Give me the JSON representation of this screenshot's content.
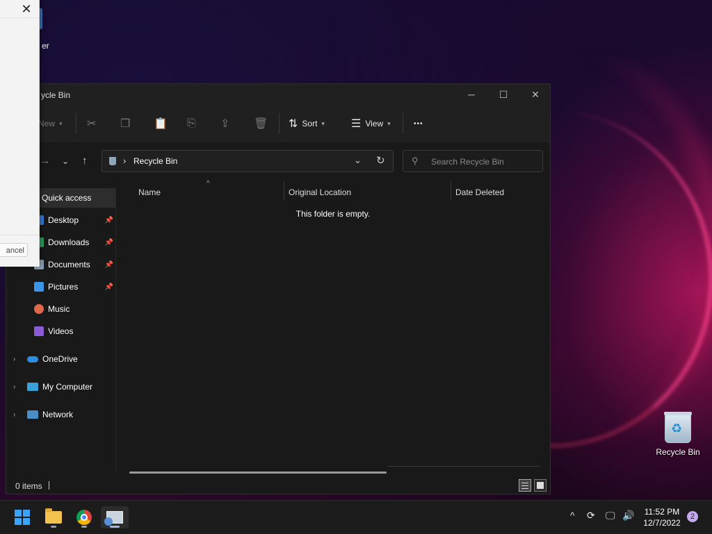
{
  "desktop": {
    "partial_icon_label": "er",
    "recycle_bin_label": "Recycle Bin"
  },
  "dialog": {
    "close_glyph": "✕",
    "cancel_label": "ancel"
  },
  "explorer": {
    "title": "ycle Bin",
    "toolbar": {
      "new_label": "New",
      "sort_label": "Sort",
      "view_label": "View",
      "more_glyph": "•••"
    },
    "address": {
      "path": "Recycle Bin"
    },
    "search": {
      "placeholder": "Search Recycle Bin"
    },
    "sidebar": {
      "quick_access": "Quick access",
      "items": [
        {
          "label": "Desktop",
          "color": "#3a7bd5",
          "pinned": true
        },
        {
          "label": "Downloads",
          "color": "#2f9e5b",
          "pinned": true
        },
        {
          "label": "Documents",
          "color": "#8fa3b8",
          "pinned": true
        },
        {
          "label": "Pictures",
          "color": "#3c94e6",
          "pinned": true
        },
        {
          "label": "Music",
          "color": "#e0694c",
          "pinned": false
        },
        {
          "label": "Videos",
          "color": "#8b5cd6",
          "pinned": false
        }
      ],
      "onedrive": "OneDrive",
      "my_computer": "My Computer",
      "network": "Network"
    },
    "columns": {
      "name": "Name",
      "original_location": "Original Location",
      "date_deleted": "Date Deleted"
    },
    "empty_message": "This folder is empty.",
    "status": {
      "items_count": "0 items"
    }
  },
  "taskbar": {
    "time": "11:52 PM",
    "date": "12/7/2022",
    "notification_count": "2"
  }
}
